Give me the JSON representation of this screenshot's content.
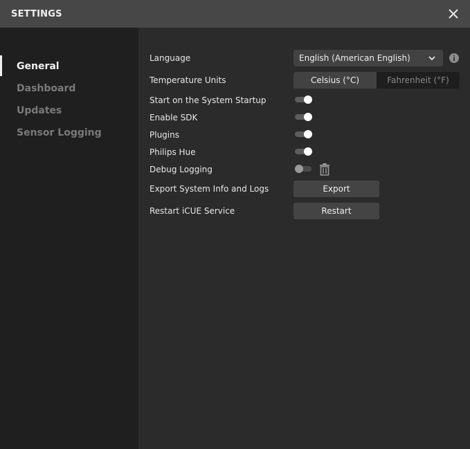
{
  "window": {
    "title": "SETTINGS"
  },
  "sidebar": {
    "items": [
      {
        "label": "General",
        "active": true
      },
      {
        "label": "Dashboard",
        "active": false
      },
      {
        "label": "Updates",
        "active": false
      },
      {
        "label": "Sensor Logging",
        "active": false
      }
    ]
  },
  "general": {
    "language": {
      "label": "Language",
      "value": "English (American English)",
      "icon": "chevron-down-icon",
      "info_icon": "info-icon"
    },
    "temperature": {
      "label": "Temperature Units",
      "options": [
        "Celsius (°C)",
        "Fahrenheit (°F)"
      ],
      "selected": "Celsius (°C)"
    },
    "toggles": [
      {
        "label": "Start on the System Startup",
        "on": true
      },
      {
        "label": "Enable SDK",
        "on": true
      },
      {
        "label": "Plugins",
        "on": true
      },
      {
        "label": "Philips Hue",
        "on": true
      },
      {
        "label": "Debug Logging",
        "on": false
      }
    ],
    "export": {
      "label": "Export System Info and Logs",
      "button": "Export"
    },
    "restart": {
      "label": "Restart iCUE Service",
      "button": "Restart"
    }
  },
  "colors": {
    "titlebar": "#474747",
    "sidebar": "#1f1f1f",
    "main": "#2b2b2b",
    "control": "#424242"
  }
}
